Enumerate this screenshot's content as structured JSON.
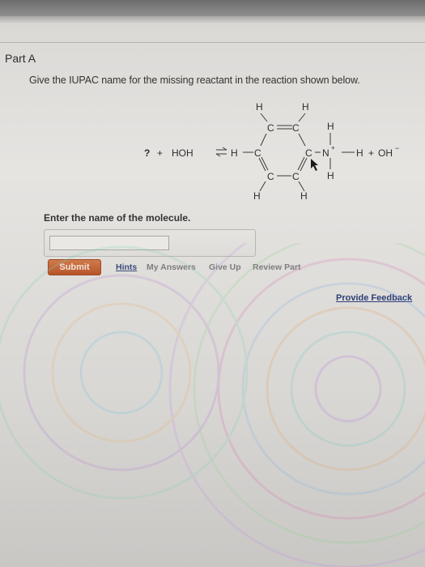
{
  "part": {
    "title": "Part A",
    "question": "Give the IUPAC name for the missing reactant in the reaction shown below."
  },
  "reaction": {
    "unknown": "?",
    "plus_1": "+",
    "water": "HOH",
    "equilibrium_arrow": "⇌",
    "plus_2": "+",
    "hydroxide": "OH",
    "hydroxide_charge": "−",
    "ammonium_n": "N",
    "ammonium_charge": "+",
    "atoms": {
      "h": "H",
      "c": "C"
    }
  },
  "answer": {
    "prompt": "Enter the name of the molecule.",
    "value": "",
    "placeholder": ""
  },
  "actions": {
    "submit": "Submit",
    "hints": "Hints",
    "my_answers": "My Answers",
    "give_up": "Give Up",
    "review_part": "Review Part",
    "feedback": "Provide Feedback"
  },
  "colors": {
    "submit_button": "#c0602f",
    "link_active": "#3a4c7a",
    "link_disabled": "#7d7d7d",
    "feedback_link": "#2d3f75"
  }
}
